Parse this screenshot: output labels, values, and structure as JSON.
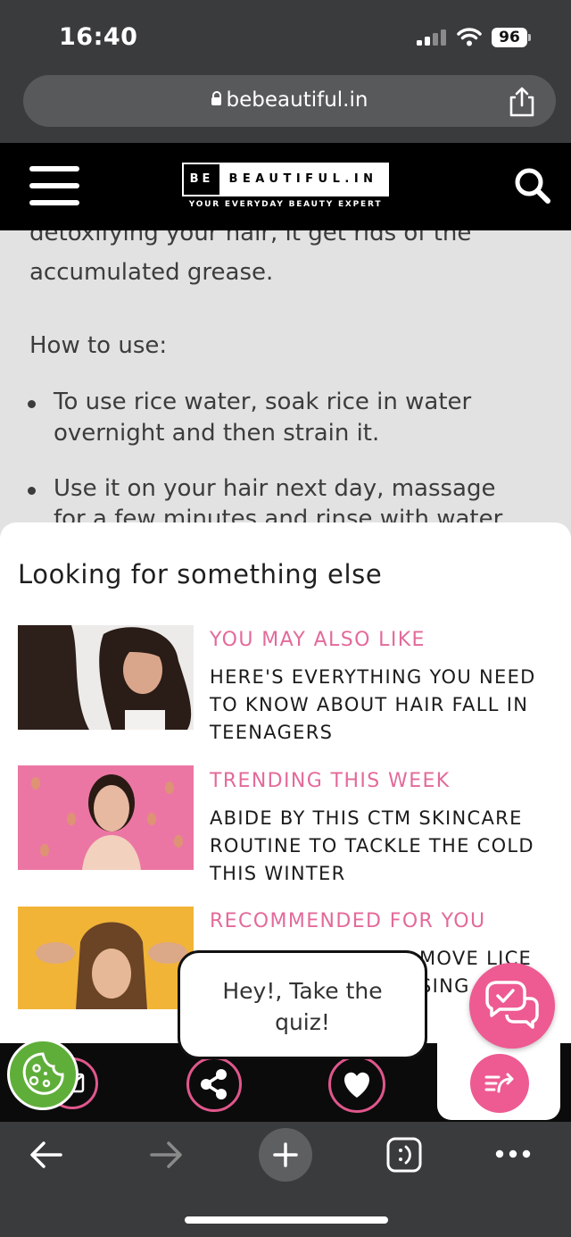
{
  "status_bar": {
    "time": "16:40",
    "battery": "96"
  },
  "browser": {
    "url": "bebeautiful.in"
  },
  "site": {
    "logo_left": "BE",
    "logo_right": "BEAUTIFUL.IN",
    "tagline": "YOUR EVERYDAY BEAUTY EXPERT"
  },
  "article": {
    "partial_line": "detoxifying your hair, it get rids of the",
    "line2": "accumulated grease.",
    "heading": "How to use:",
    "bullets": [
      {
        "line1": "To use rice water, soak rice in water",
        "line2": "overnight and then strain it."
      },
      {
        "line1": "Use it on your hair next day, massage",
        "line2": "for a few minutes and rinse with water."
      }
    ]
  },
  "sheet": {
    "title": "Looking for something else",
    "items": [
      {
        "label": "YOU MAY ALSO LIKE",
        "title_lines": [
          "HERE'S EVERYTHING YOU NEED",
          "TO KNOW ABOUT HAIR FALL IN",
          "TEENAGERS"
        ]
      },
      {
        "label": "TRENDING THIS WEEK",
        "title_lines": [
          "ABIDE BY THIS CTM SKINCARE",
          "ROUTINE TO TACKLE THE COLD",
          "THIS WINTER"
        ]
      },
      {
        "label": "RECOMMENDED FOR YOU",
        "title_lines": [
          "MOVE LICE",
          "SING"
        ]
      }
    ]
  },
  "quiz": {
    "line1": "Hey!, Take the",
    "line2": "quiz!"
  },
  "colors": {
    "accent_pink": "#ee5a92",
    "label_pink": "#e36a9a",
    "cookie_green": "#5fae3a",
    "chrome_dark": "#3a3b3c"
  }
}
